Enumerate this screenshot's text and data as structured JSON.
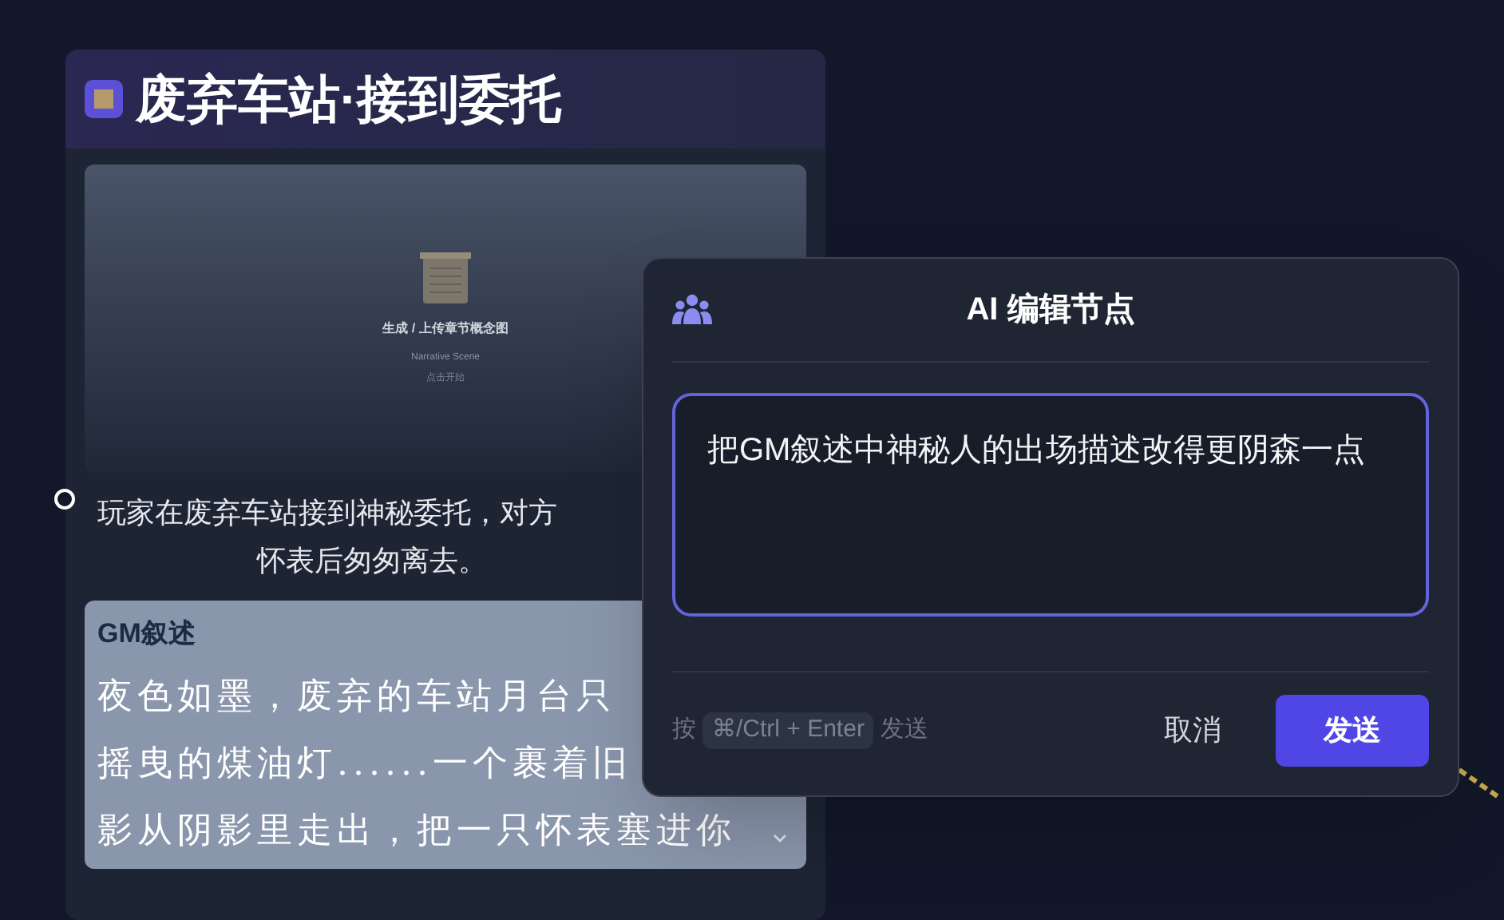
{
  "node": {
    "title": "废弃车站·接到委托",
    "cover": {
      "title": "生成 / 上传章节概念图",
      "subtitle": "Narrative Scene",
      "hint": "点击开始"
    },
    "summary_lines": [
      "玩家在废弃车站接到神秘委托，对方",
      "怀表后匆匆离去。"
    ],
    "gm": {
      "label": "GM叙述",
      "lines": [
        "夜色如墨，废弃的车站月台只",
        "摇曳的煤油灯......一个裹着旧",
        "影从阴影里走出，把一只怀表塞进你"
      ],
      "expanded": false
    }
  },
  "dialog": {
    "title": "AI 编辑节点",
    "prompt": "把GM叙述中神秘人的出场描述改得更阴森一点",
    "hint_before": "按",
    "shortcut": "⌘/Ctrl + Enter",
    "hint_after": "发送",
    "buttons": [
      {
        "label": "取消",
        "kind": "secondary"
      },
      {
        "label": "发送",
        "kind": "primary"
      }
    ]
  }
}
